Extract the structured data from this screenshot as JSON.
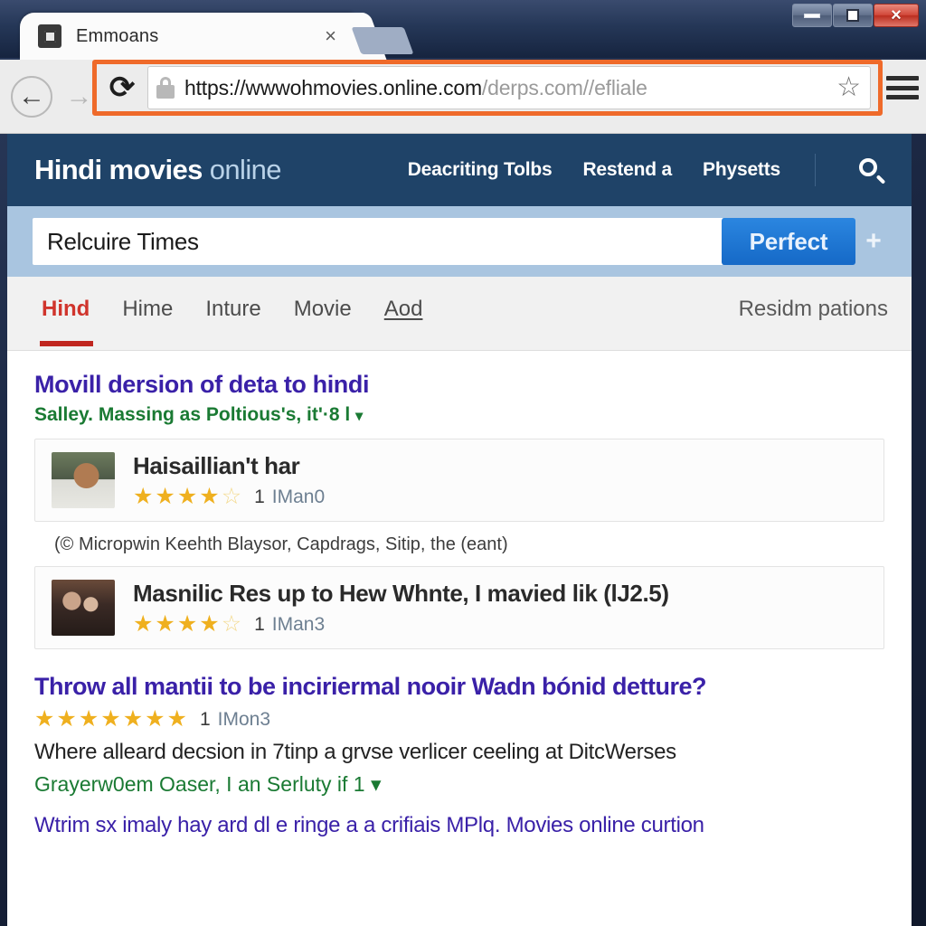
{
  "window": {
    "controls": {
      "minimize": "minimize",
      "maximize": "maximize",
      "close": "×"
    }
  },
  "browser": {
    "tab": {
      "title": "Emmoans",
      "close": "×",
      "favicon": "page-favicon"
    },
    "back": "←",
    "forward": "→",
    "reload": "⟳",
    "url": {
      "scheme_host": "https://wwwohmovies.online.com",
      "path": "/derps.com//efliale"
    },
    "bookmark_star": "☆",
    "menu": "menu-icon"
  },
  "site": {
    "brand_bold": "Hindi movies",
    "brand_light": "online",
    "nav": [
      {
        "label": "Deacriting Tolbs"
      },
      {
        "label": "Restend a"
      },
      {
        "label": "Physetts"
      }
    ],
    "search_icon": "search-icon"
  },
  "search": {
    "value": "Relcuire Times",
    "submit_label": "Perfect",
    "plus_label": "+"
  },
  "tabnav": {
    "items": [
      {
        "label": "Hind",
        "active": true
      },
      {
        "label": "Hime",
        "active": false
      },
      {
        "label": "Inture",
        "active": false
      },
      {
        "label": "Movie",
        "active": false
      },
      {
        "label": "Aod",
        "active": false
      }
    ],
    "right_label": "Residm pations"
  },
  "results": {
    "headline": "Movill dersion of deta to hindi",
    "subline": "Salley. Massing as Poltious's, it'·8 l",
    "subline_caret": "▾",
    "cards": [
      {
        "title": "Haisaillian't har",
        "stars_filled": 4,
        "stars_total": 5,
        "count": "1",
        "source": "IMan0"
      }
    ],
    "note": "(© Micropwin Keehth Blaysor, Capdrags, Sitip, the (eant)",
    "cards2": [
      {
        "title": "Masnilic Res up to Hew Whnte, I mavied lik (lJ2.5)",
        "stars_filled": 4,
        "stars_total": 5,
        "count": "1",
        "source": "IMan3"
      }
    ],
    "block3": {
      "title": "Throw all mantii to be inciriermal nooir Wadn bónid detture?",
      "stars_filled": 7,
      "stars_total": 7,
      "count": "1",
      "source": "IMon3",
      "desc": "Where alleard decsion in 7tinp a grvse verlicer ceeling at DitcWerses",
      "green": "Grayerw0em Oaser, I an Serluty if 1",
      "green_caret": "▾",
      "last_line": "Wtrim sx imaly hay ard dl e ringe a a crifiais MPlq. Movies online curtion"
    }
  },
  "colors": {
    "header_blue": "#1f4368",
    "strip_blue": "#a9c5e0",
    "accent_orange": "#ef6a2a",
    "link_purple": "#3a21a8",
    "green": "#1a7a33",
    "red_tab": "#d0342c",
    "star_gold": "#efb01f",
    "button_blue": "#1569c7"
  }
}
